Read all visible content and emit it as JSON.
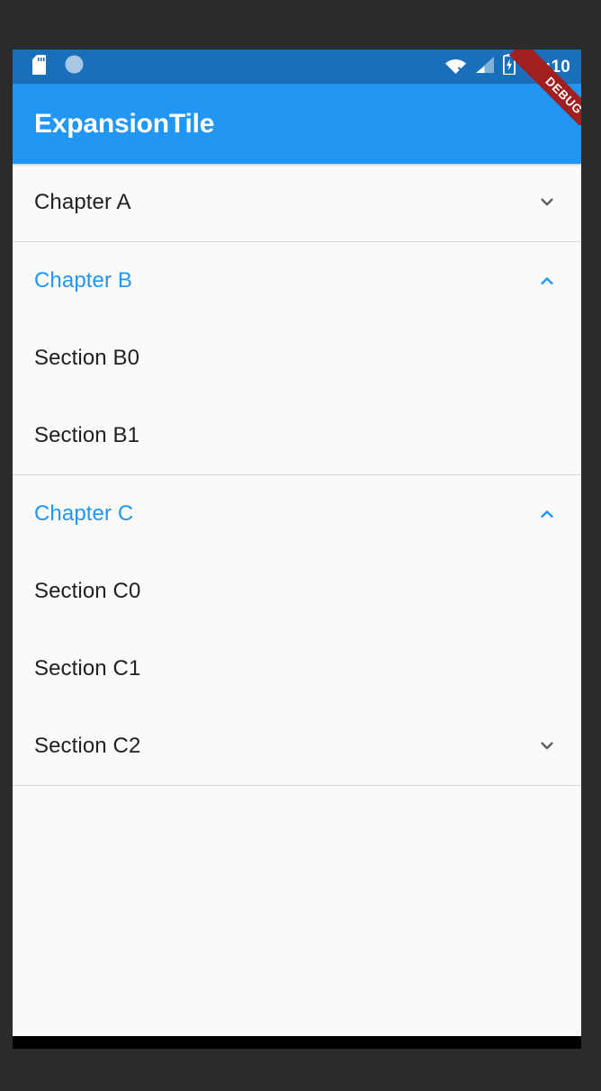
{
  "status_bar": {
    "clock": "12:10",
    "icons_left": [
      "sd-card-icon",
      "sync-circle-icon"
    ],
    "icons_right": [
      "wifi-off-icon",
      "cellular-signal-icon",
      "battery-charging-icon"
    ],
    "background_color": "#1a6fba"
  },
  "debug_ribbon": {
    "label": "DEBUG",
    "color": "#a02020"
  },
  "app_bar": {
    "title": "ExpansionTile",
    "background_color": "#2196f3",
    "text_color": "#ffffff"
  },
  "theme": {
    "accent_color": "#2196f3",
    "body_background": "#fafafa",
    "primary_text": "#212121",
    "divider_color": "#d8d8d8",
    "chevron_collapsed_color": "#616161"
  },
  "list": {
    "items": [
      {
        "label": "Chapter A",
        "expanded": false,
        "accent": false,
        "trailing_icon": "chevron-down-icon",
        "children": []
      },
      {
        "label": "Chapter B",
        "expanded": true,
        "accent": true,
        "trailing_icon": "chevron-up-icon",
        "children": [
          {
            "label": "Section B0",
            "trailing_icon": null
          },
          {
            "label": "Section B1",
            "trailing_icon": null
          }
        ]
      },
      {
        "label": "Chapter C",
        "expanded": true,
        "accent": true,
        "trailing_icon": "chevron-up-icon",
        "children": [
          {
            "label": "Section C0",
            "trailing_icon": null
          },
          {
            "label": "Section C1",
            "trailing_icon": null
          },
          {
            "label": "Section C2",
            "trailing_icon": "chevron-down-icon"
          }
        ]
      }
    ]
  },
  "nav_bar": {
    "buttons": [
      {
        "name": "back-button",
        "icon": "triangle-back-icon"
      },
      {
        "name": "home-button",
        "icon": "circle-home-icon"
      },
      {
        "name": "recents-button",
        "icon": "square-recents-icon"
      }
    ],
    "background_color": "#000000"
  }
}
